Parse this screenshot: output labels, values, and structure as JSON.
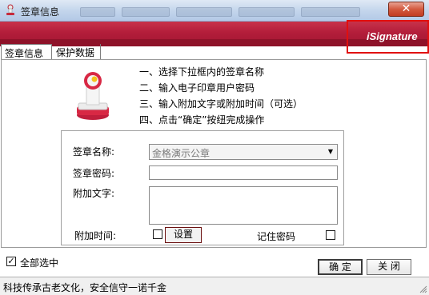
{
  "window": {
    "title": "签章信息",
    "close_label": "✕"
  },
  "banner": {
    "logo_text": "iSignature",
    "accent_color": "#b31d3a",
    "highlight_color": "#e10f0f"
  },
  "tabs": [
    {
      "label": "签章信息",
      "active": true
    },
    {
      "label": "保护数据",
      "active": false
    }
  ],
  "steps": [
    "一、选择下拉框内的签章名称",
    "二、输入电子印章用户密码",
    "三、输入附加文字或附加时间（可选）",
    "四、点击“确定”按纽完成操作"
  ],
  "form": {
    "name_label": "签章名称:",
    "name_value": "金格演示公章",
    "password_label": "签章密码:",
    "password_value": "",
    "text_label": "附加文字:",
    "text_value": "",
    "time_label": "附加时间:",
    "time_checked": false,
    "set_button": "设置",
    "remember_label": "记住密码",
    "remember_checked": false
  },
  "footer": {
    "select_all_label": "全部选中",
    "select_all_checked": true,
    "ok_button": "确 定",
    "close_button": "关 闭"
  },
  "status": {
    "text": "科技传承古老文化，安全信守一诺千金"
  }
}
